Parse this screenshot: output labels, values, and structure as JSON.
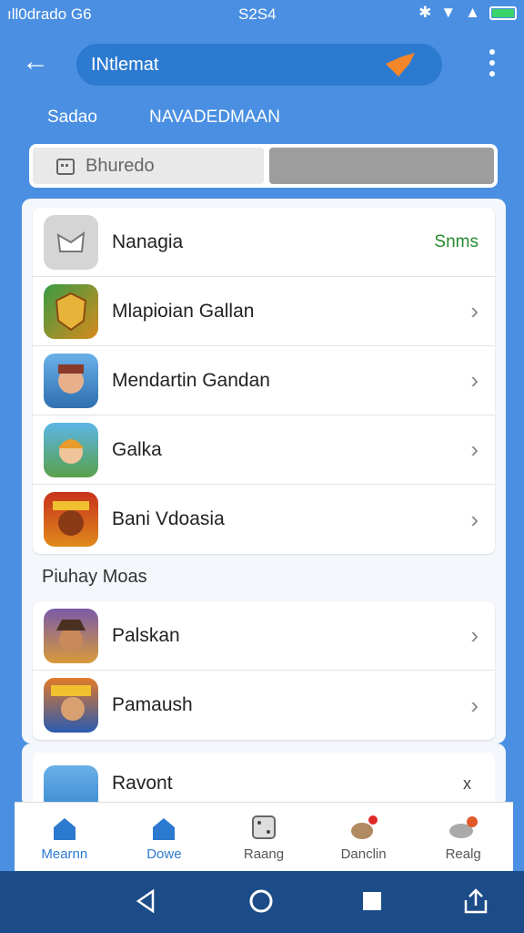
{
  "status_bar": {
    "carrier": "ıll0drado G6",
    "time": "S2S4"
  },
  "header": {
    "search_text": "INtlemat"
  },
  "top_tabs": [
    "Sadao",
    "NAVADEDMAAN"
  ],
  "segment": {
    "left_label": "Bhuredo"
  },
  "list_primary": [
    {
      "label": "Nanagia",
      "suffix": "Snms",
      "icon": "gamepad-icon"
    },
    {
      "label": "Mlapioian Gallan",
      "icon": "shield-game-icon"
    },
    {
      "label": "Mendartin Gandan",
      "icon": "hero-game-icon"
    },
    {
      "label": "Galka",
      "icon": "girl-game-icon"
    },
    {
      "label": "Bani Vdoasia",
      "icon": "monster-game-icon"
    }
  ],
  "group_heading": "Piuhay Moas",
  "list_secondary": [
    {
      "label": "Palskan",
      "icon": "pirate-game-icon"
    },
    {
      "label": "Pamaush",
      "icon": "arcade-game-icon"
    }
  ],
  "peek_row": {
    "label": "Ravont",
    "suffix": "x"
  },
  "bottom_tabs": [
    {
      "label": "Mearnn",
      "icon": "home-icon",
      "active": true
    },
    {
      "label": "Dowe",
      "icon": "home-alt-icon",
      "active": true
    },
    {
      "label": "Raang",
      "icon": "dice-icon",
      "active": false
    },
    {
      "label": "Danclin",
      "icon": "pet-icon",
      "active": false
    },
    {
      "label": "Realg",
      "icon": "animal-icon",
      "active": false
    }
  ],
  "colors": {
    "accent": "#2c7ad0",
    "background": "#4a8fe2",
    "positive": "#268a2e"
  }
}
